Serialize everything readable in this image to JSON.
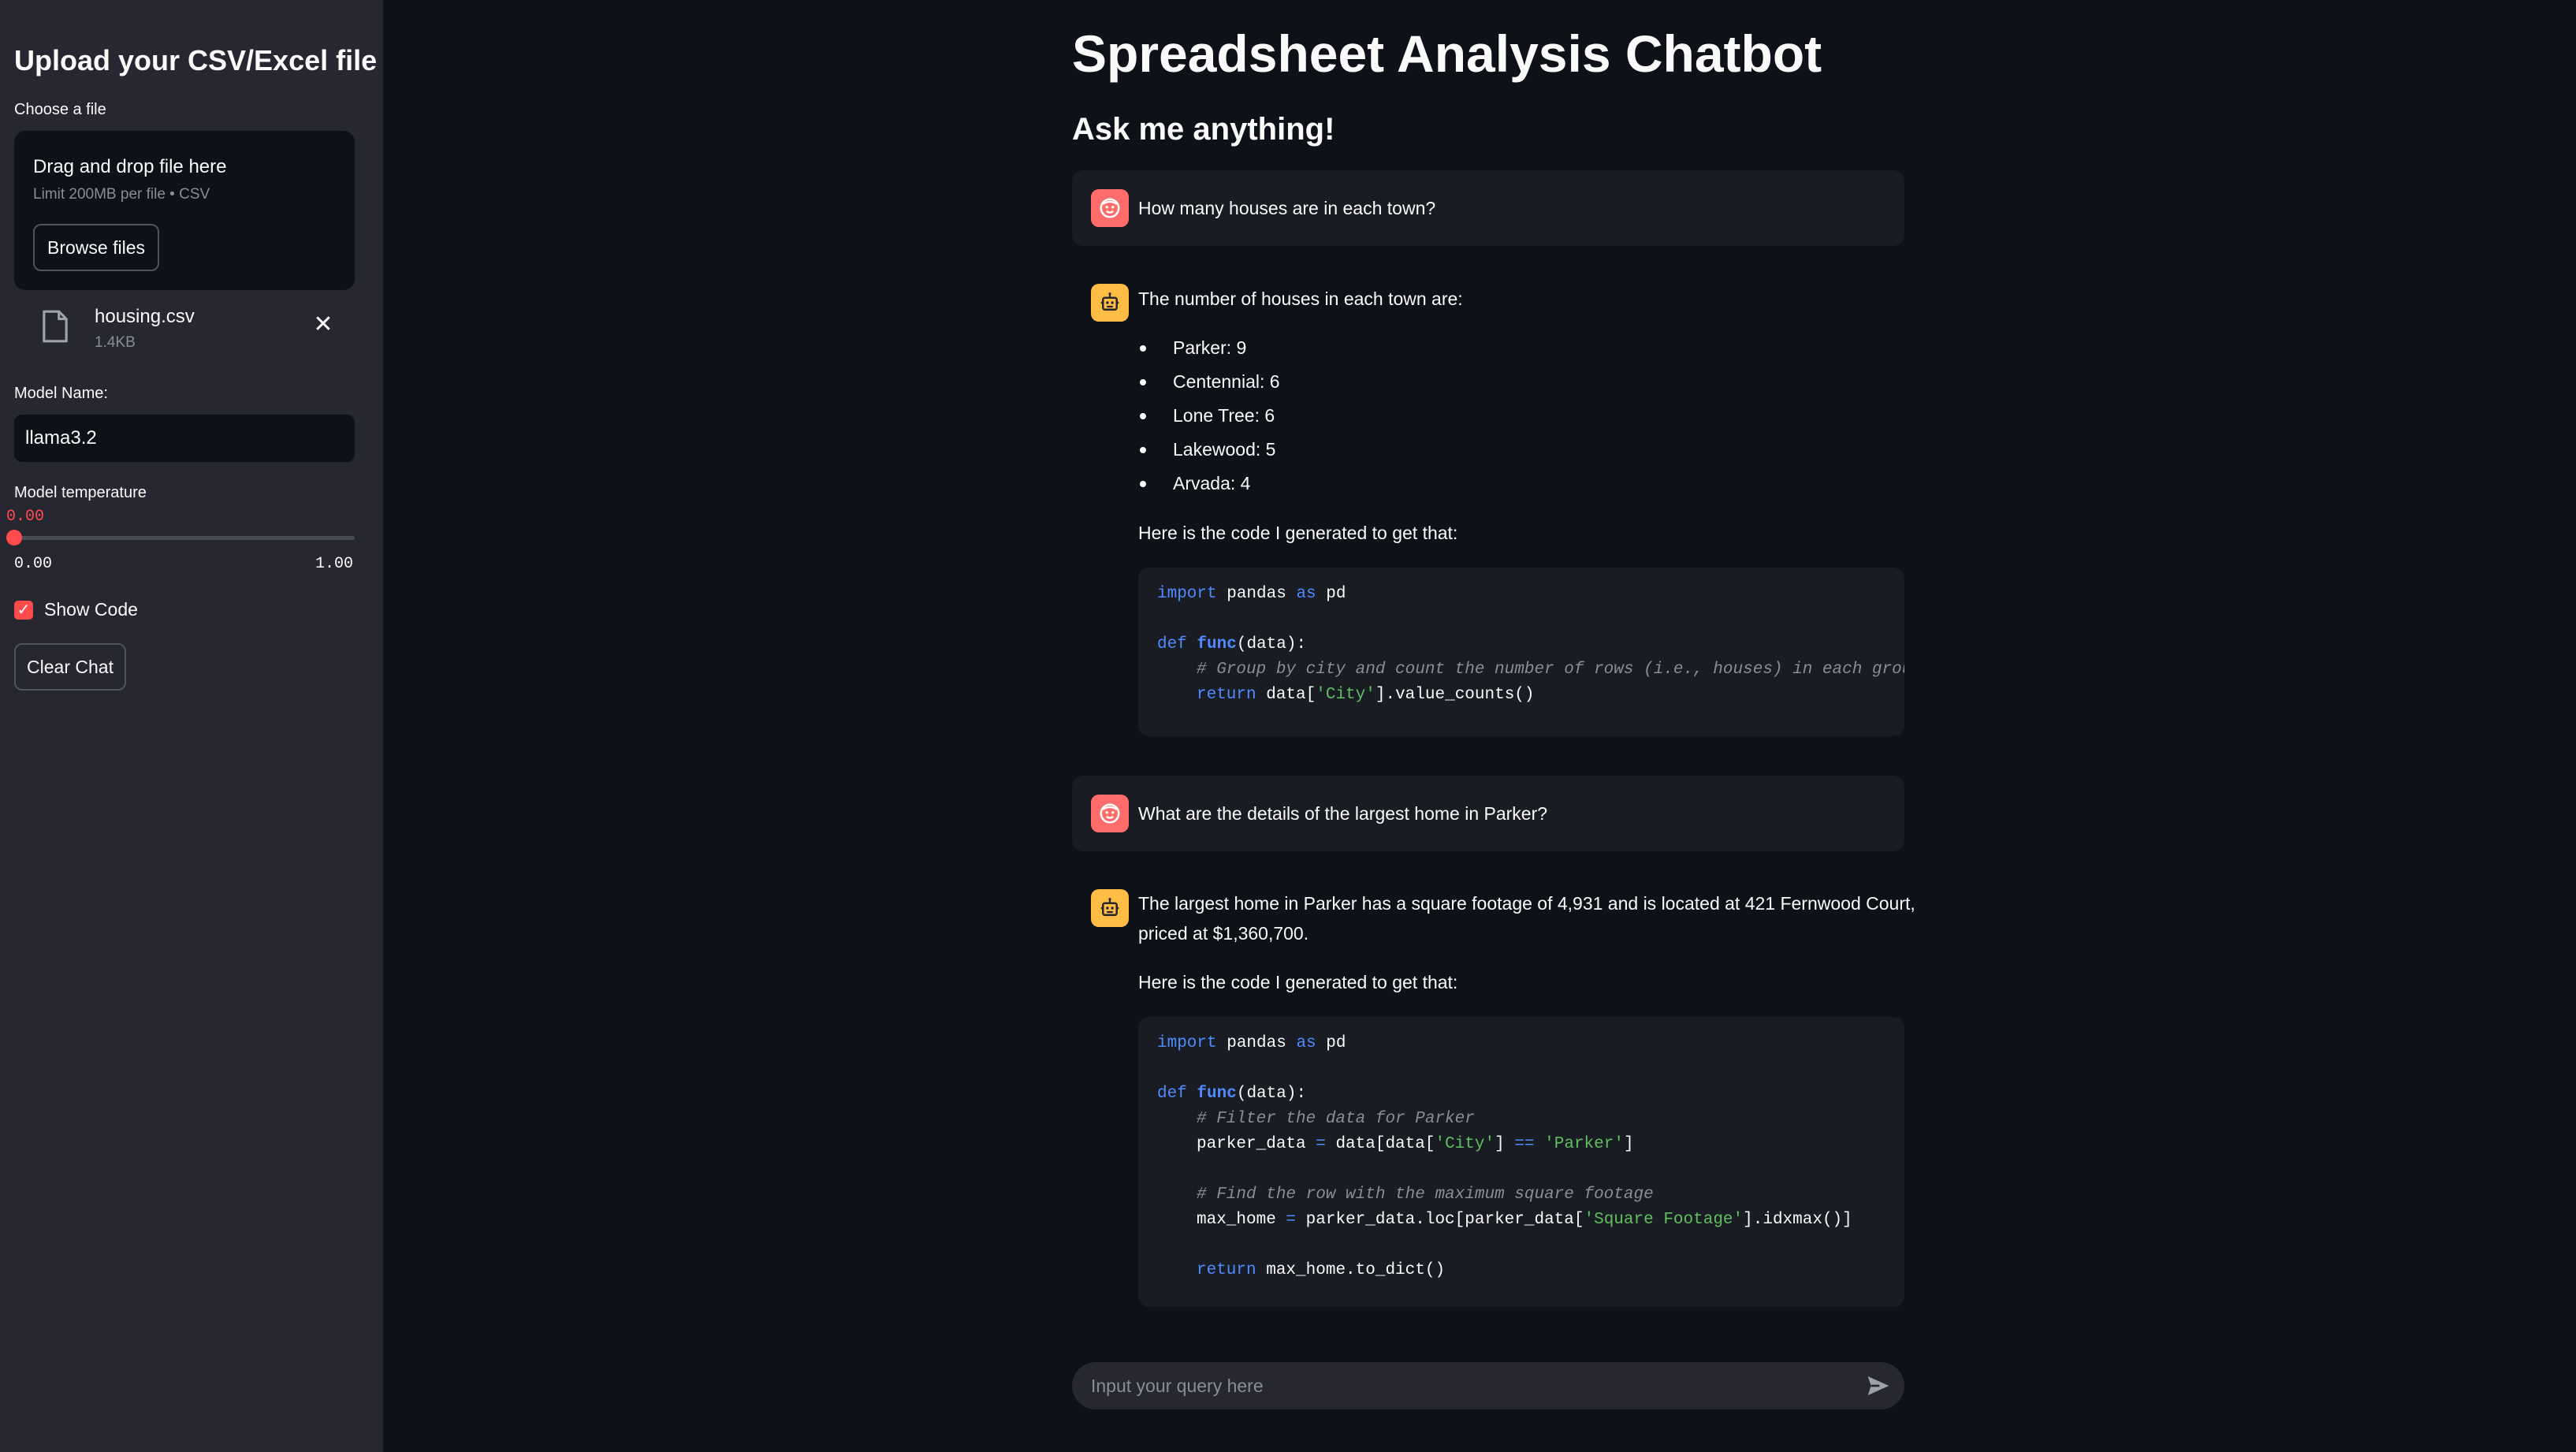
{
  "sidebar": {
    "title": "Upload your CSV/Excel file",
    "file_label": "Choose a file",
    "dropzone": {
      "title": "Drag and drop file here",
      "limit": "Limit 200MB per file • CSV",
      "browse_label": "Browse files"
    },
    "uploaded_file": {
      "name": "housing.csv",
      "size": "1.4KB"
    },
    "model_name": {
      "label": "Model Name:",
      "value": "llama3.2"
    },
    "temperature": {
      "label": "Model temperature",
      "value": "0.00",
      "min": "0.00",
      "max": "1.00",
      "fraction": 0
    },
    "show_code": {
      "label": "Show Code",
      "checked": true
    },
    "clear_label": "Clear Chat"
  },
  "main": {
    "title": "Spreadsheet Analysis Chatbot",
    "subtitle": "Ask me anything!"
  },
  "messages": [
    {
      "role": "user",
      "text": "How many houses are in each town?"
    },
    {
      "role": "assistant",
      "text": "The number of houses in each town are:",
      "bullets": [
        "Parker: 9",
        "Centennial: 6",
        "Lone Tree: 6",
        "Lakewood: 5",
        "Arvada: 4"
      ],
      "code_intro": "Here is the code I generated to get that:",
      "code_lines": [
        {
          "kw1": "import",
          "a": " pandas ",
          "kw2": "as",
          "b": " pd"
        },
        {
          "def": "def",
          "fn": "func",
          "rest": "(data):"
        },
        {
          "comment": "# Group by city and count the number of rows (i.e., houses) in each group"
        },
        {
          "kw": "return",
          "a": " data[",
          "str": "'City'",
          "b": "].value_counts()"
        }
      ]
    },
    {
      "role": "user",
      "text": "What are the details of the largest home in Parker?"
    },
    {
      "role": "assistant",
      "text_line1": "The largest home in Parker has a square footage of 4,931 and is located at 421 Fernwood Court,",
      "text_line2": "priced at $1,360,700.",
      "code_intro": "Here is the code I generated to get that:",
      "code_lines": [
        {
          "kw1": "import",
          "a": " pandas ",
          "kw2": "as",
          "b": " pd"
        },
        {
          "def": "def",
          "fn": "func",
          "rest": "(data):"
        },
        {
          "comment": "# Filter the data for Parker"
        },
        {
          "a": "parker_data ",
          "op": "=",
          "b": " data[data[",
          "str": "'City'",
          "c": "] ",
          "op2": "==",
          "d": " ",
          "str2": "'Parker'",
          "e": "]"
        },
        {
          "comment": "# Find the row with the maximum square footage"
        },
        {
          "a": "max_home ",
          "op": "=",
          "b": " parker_data.loc[parker_data[",
          "str": "'Square Footage'",
          "c": "].idxmax()]"
        },
        {
          "kw": "return",
          "a": " max_home.to_dict()"
        }
      ]
    }
  ],
  "chat_input": {
    "placeholder": "Input your query here"
  },
  "icons": {
    "user_avatar": "face-icon",
    "bot_avatar": "robot-icon",
    "file": "file-icon",
    "close": "close-icon",
    "send": "send-icon"
  },
  "colors": {
    "accent": "#ff4b4b",
    "user_avatar": "#ff6c6c",
    "bot_avatar": "#ffbd45",
    "background": "#0e1117",
    "sidebar": "#262730"
  }
}
